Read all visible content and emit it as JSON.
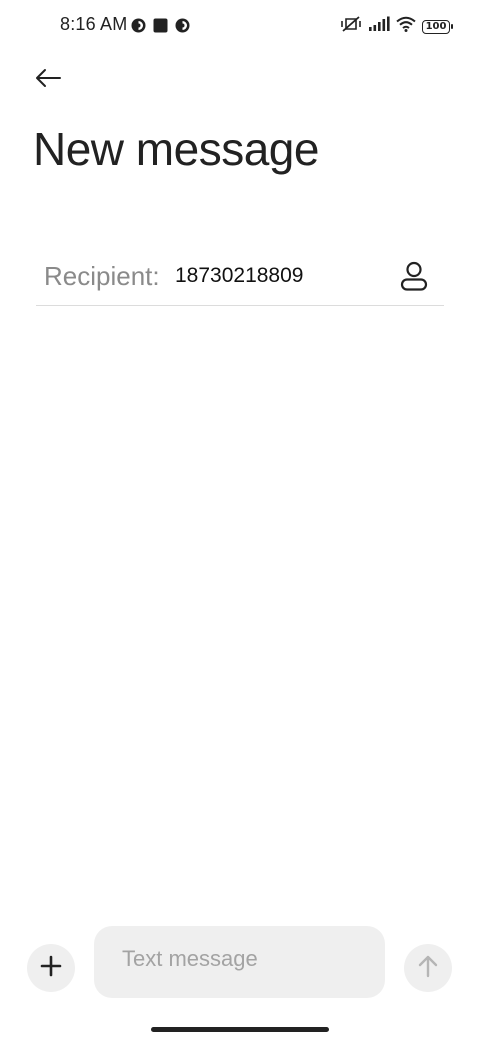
{
  "status_bar": {
    "time": "8:16 AM",
    "battery": "100",
    "left_icons": [
      "app-notification-icon",
      "square-notification-icon",
      "app-notification-icon"
    ],
    "right_icons": [
      "mute-vibrate-icon",
      "signal-icon",
      "wifi-icon",
      "battery-icon"
    ]
  },
  "header": {
    "back_icon": "back-arrow-icon",
    "title": "New message"
  },
  "recipient": {
    "label": "Recipient:",
    "value": "18730218809",
    "contact_icon": "contact-person-icon"
  },
  "composer": {
    "attach_icon": "plus-icon",
    "placeholder": "Text message",
    "send_icon": "send-arrow-up-icon"
  },
  "colors": {
    "background": "#ffffff",
    "composer_bg": "#efefef",
    "placeholder": "#a3a3a3",
    "label": "#8a8a8a",
    "divider": "#dcdcdc",
    "send_icon_disabled": "#b5b5b5"
  }
}
